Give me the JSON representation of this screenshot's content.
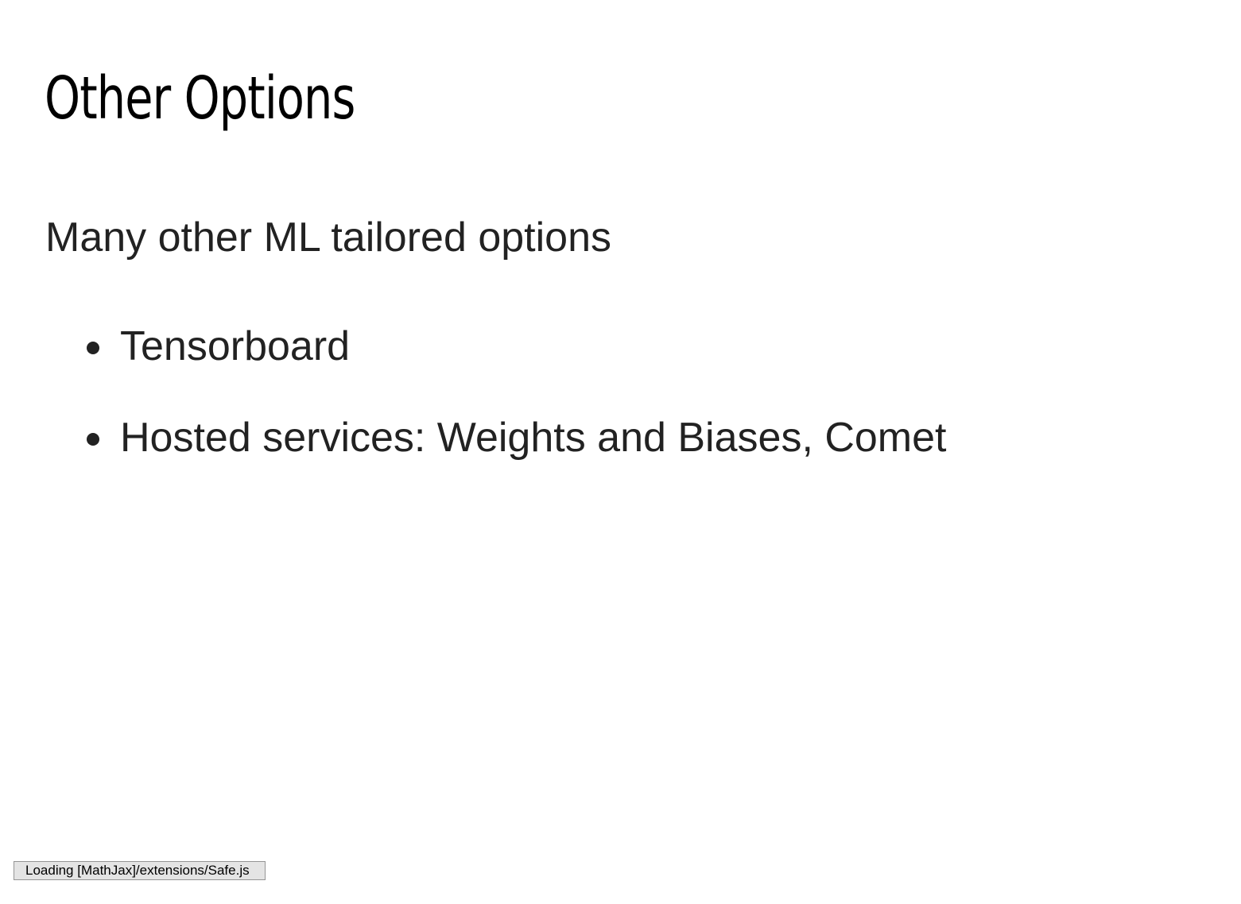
{
  "slide": {
    "title": "Other Options",
    "intro": "Many other ML tailored options",
    "bullets": [
      "Tensorboard",
      "Hosted services: Weights and Biases, Comet"
    ]
  },
  "status": {
    "message": "Loading [MathJax]/extensions/Safe.js"
  },
  "colors": {
    "background": "#ffffff",
    "title": "#000000",
    "body_text": "#222222",
    "status_bg": "#e4e4e4",
    "status_border": "#959595"
  }
}
